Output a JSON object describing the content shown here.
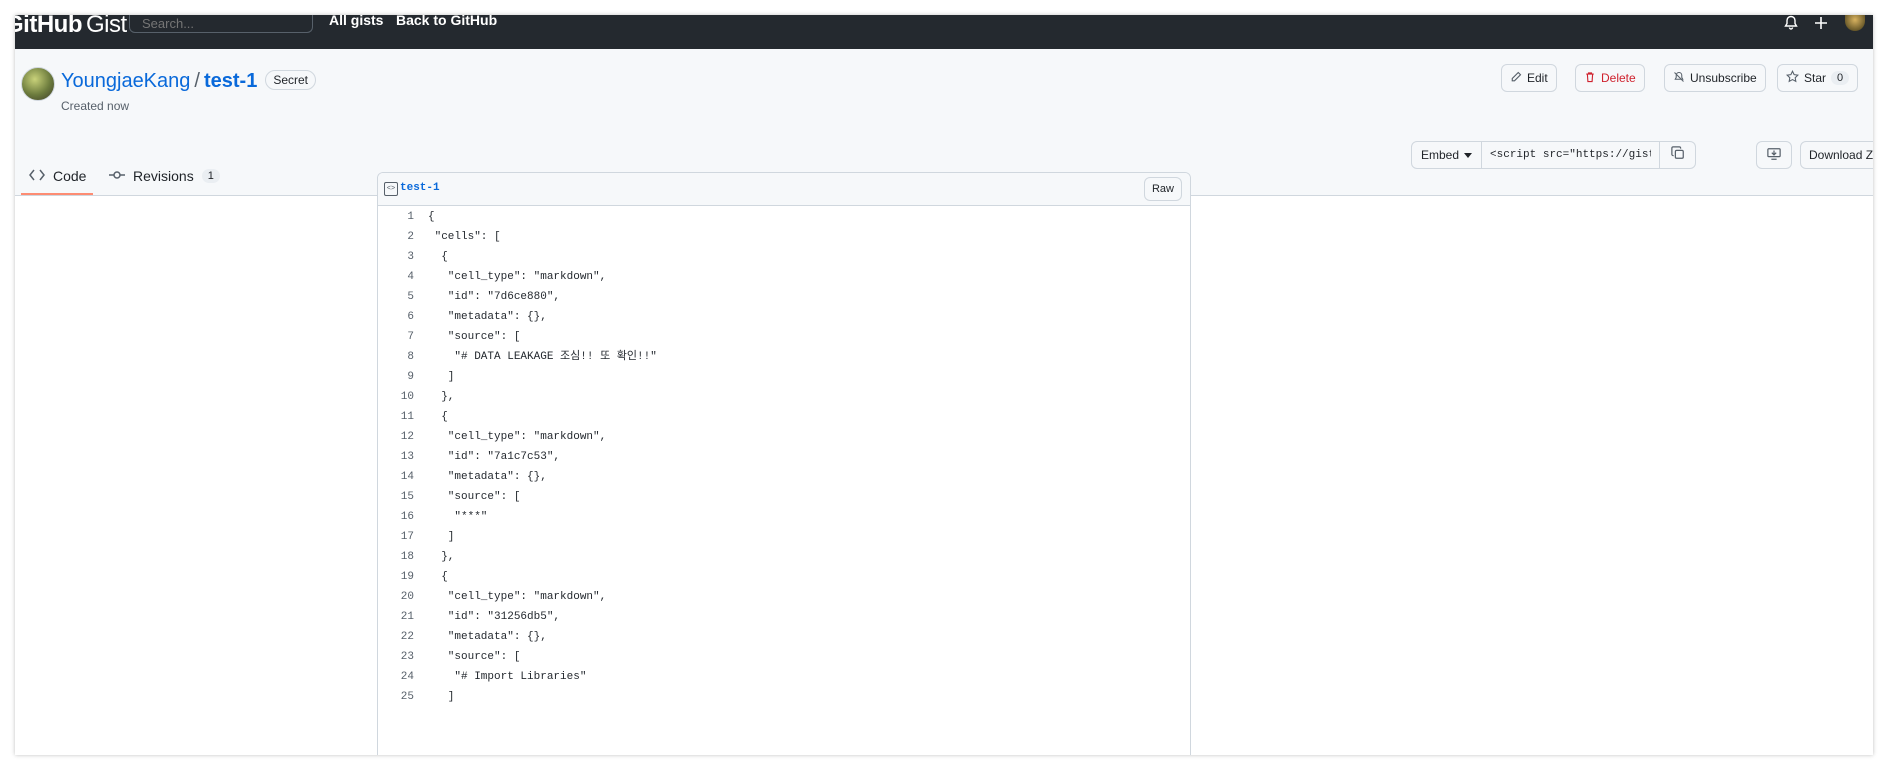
{
  "header": {
    "brand": "GitHub",
    "brand_suffix": "Gist",
    "search_placeholder": "Search...",
    "nav": [
      "All gists",
      "Back to GitHub"
    ],
    "icons": [
      "bell-icon",
      "plus-icon",
      "avatar"
    ]
  },
  "gist": {
    "owner": "YoungjaeKang",
    "separator": "/",
    "name": "test-1",
    "visibility": "Secret",
    "created": "Created now",
    "actions": {
      "edit": "Edit",
      "delete": "Delete",
      "unsubscribe": "Unsubscribe",
      "star": "Star",
      "star_count": "0"
    },
    "tabs": {
      "code": "Code",
      "revisions": "Revisions",
      "revisions_count": "1"
    },
    "embed": {
      "label": "Embed",
      "value": "<script src=\"https://gist",
      "download": "Download ZIP"
    }
  },
  "file": {
    "name": "test-1",
    "raw": "Raw",
    "lines": [
      "{",
      " \"cells\": [",
      "  {",
      "   \"cell_type\": \"markdown\",",
      "   \"id\": \"7d6ce880\",",
      "   \"metadata\": {},",
      "   \"source\": [",
      "    \"# DATA LEAKAGE 조심!! 또 확인!!\"",
      "   ]",
      "  },",
      "  {",
      "   \"cell_type\": \"markdown\",",
      "   \"id\": \"7a1c7c53\",",
      "   \"metadata\": {},",
      "   \"source\": [",
      "    \"***\"",
      "   ]",
      "  },",
      "  {",
      "   \"cell_type\": \"markdown\",",
      "   \"id\": \"31256db5\",",
      "   \"metadata\": {},",
      "   \"source\": [",
      "    \"# Import Libraries\"",
      "   ]"
    ]
  },
  "colors": {
    "header_bg": "#24292f",
    "link": "#0969da",
    "danger": "#cf222e",
    "tab_underline": "#fd8c73"
  }
}
